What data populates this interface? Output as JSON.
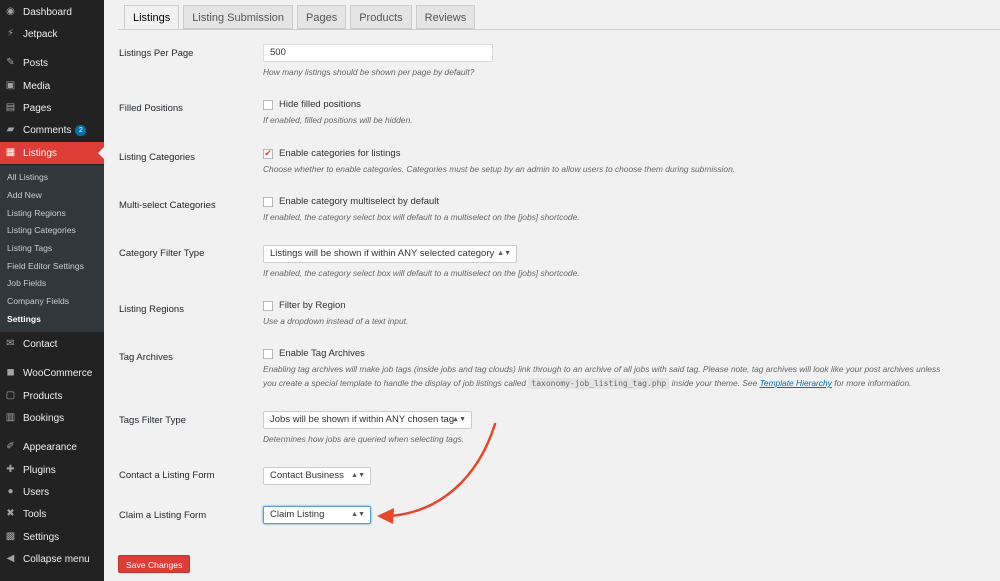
{
  "sidebar": {
    "items": [
      {
        "label": "Dashboard",
        "icon": "dashboard-icon"
      },
      {
        "label": "Jetpack",
        "icon": "jetpack-icon"
      },
      {
        "label": "Posts",
        "icon": "pin-icon"
      },
      {
        "label": "Media",
        "icon": "media-icon"
      },
      {
        "label": "Pages",
        "icon": "pages-icon"
      },
      {
        "label": "Comments",
        "icon": "comments-icon",
        "badge": "2"
      },
      {
        "label": "Listings",
        "icon": "listings-icon"
      },
      {
        "label": "Contact",
        "icon": "mail-icon"
      },
      {
        "label": "WooCommerce",
        "icon": "woocommerce-icon"
      },
      {
        "label": "Products",
        "icon": "products-icon"
      },
      {
        "label": "Bookings",
        "icon": "calendar-icon"
      },
      {
        "label": "Appearance",
        "icon": "brush-icon"
      },
      {
        "label": "Plugins",
        "icon": "plugin-icon"
      },
      {
        "label": "Users",
        "icon": "users-icon"
      },
      {
        "label": "Tools",
        "icon": "wrench-icon"
      },
      {
        "label": "Settings",
        "icon": "settings-icon"
      },
      {
        "label": "Collapse menu",
        "icon": "collapse-icon"
      }
    ],
    "submenu": [
      "All Listings",
      "Add New",
      "Listing Regions",
      "Listing Categories",
      "Listing Tags",
      "Field Editor Settings",
      "Job Fields",
      "Company Fields",
      "Settings"
    ]
  },
  "tabs": [
    "Listings",
    "Listing Submission",
    "Pages",
    "Products",
    "Reviews"
  ],
  "settings": {
    "per_page": {
      "label": "Listings Per Page",
      "value": "500",
      "desc": "How many listings should be shown per page by default?"
    },
    "filled": {
      "label": "Filled Positions",
      "cb": "Hide filled positions",
      "desc": "If enabled, filled positions will be hidden."
    },
    "categories": {
      "label": "Listing Categories",
      "cb": "Enable categories for listings",
      "desc": "Choose whether to enable categories. Categories must be setup by an admin to allow users to choose them during submission."
    },
    "multiselect": {
      "label": "Multi-select Categories",
      "cb": "Enable category multiselect by default",
      "desc": "If enabled, the category select box will default to a multiselect on the [jobs] shortcode."
    },
    "filter_type": {
      "label": "Category Filter Type",
      "value": "Listings will be shown if within ANY selected category",
      "desc": "If enabled, the category select box will default to a multiselect on the [jobs] shortcode."
    },
    "regions": {
      "label": "Listing Regions",
      "cb": "Filter by Region",
      "desc": "Use a dropdown instead of a text input."
    },
    "tag_archives": {
      "label": "Tag Archives",
      "cb": "Enable Tag Archives",
      "desc1": "Enabling tag archives will make job tags (inside jobs and tag clouds) link through to an archive of all jobs with said tag. Please note, tag archives will look like your post archives unless",
      "desc2a": "you create a special template to handle the display of job listings called",
      "code": "taxonomy-job_listing_tag.php",
      "desc2b": "inside your theme. See",
      "link": "Template Hierarchy",
      "desc2c": "for more information."
    },
    "tag_filter": {
      "label": "Tags Filter Type",
      "value": "Jobs will be shown if within ANY chosen tag",
      "desc": "Determines how jobs are queried when selecting tags."
    },
    "contact_form": {
      "label": "Contact a Listing Form",
      "value": "Contact Business"
    },
    "claim_form": {
      "label": "Claim a Listing Form",
      "value": "Claim Listing"
    }
  },
  "save_label": "Save Changes",
  "colors": {
    "accent": "#dd3d36",
    "sidebar": "#222222",
    "arrow": "#e8462d"
  }
}
